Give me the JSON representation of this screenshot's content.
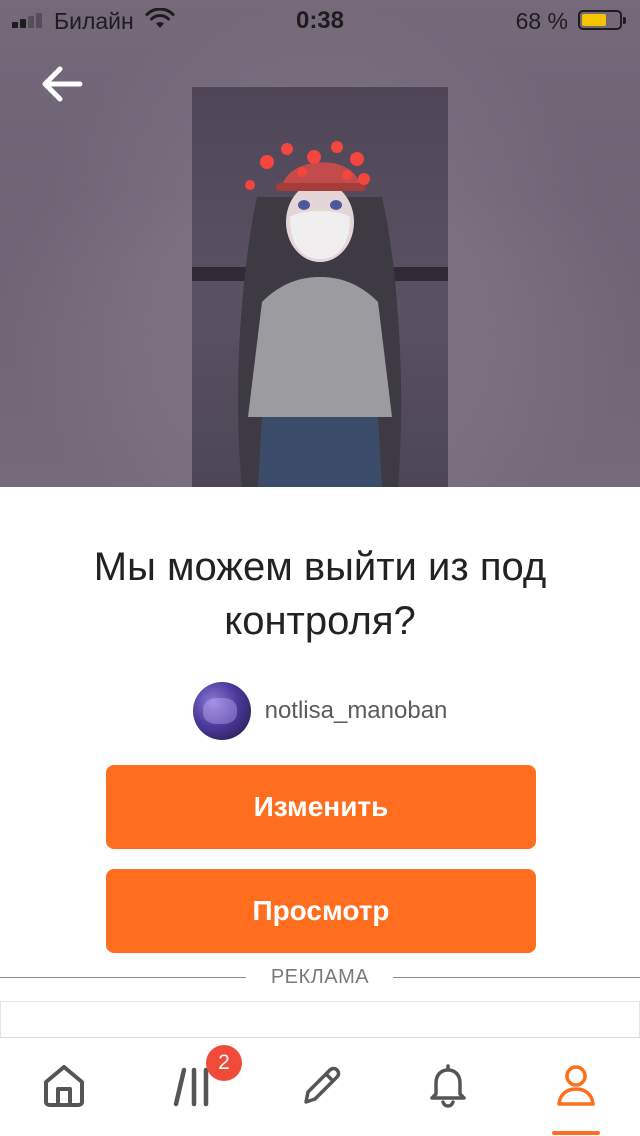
{
  "status_bar": {
    "carrier": "Билайн",
    "time": "0:38",
    "battery_percent_label": "68 %",
    "battery_level": 0.68
  },
  "story": {
    "title": "Мы можем выйти из под контроля?",
    "author": "notlisa_manoban"
  },
  "actions": {
    "edit_label": "Изменить",
    "view_label": "Просмотр"
  },
  "ad": {
    "label": "РЕКЛАМА"
  },
  "tabbar": {
    "library_badge": "2",
    "active_tab": "profile"
  },
  "colors": {
    "accent": "#ff6e1f",
    "badge": "#f04b38",
    "battery": "#f5c400"
  },
  "icons": [
    "back-arrow-icon",
    "signal-icon",
    "wifi-icon",
    "battery-icon",
    "home-icon",
    "library-icon",
    "pencil-icon",
    "bell-icon",
    "profile-icon"
  ]
}
